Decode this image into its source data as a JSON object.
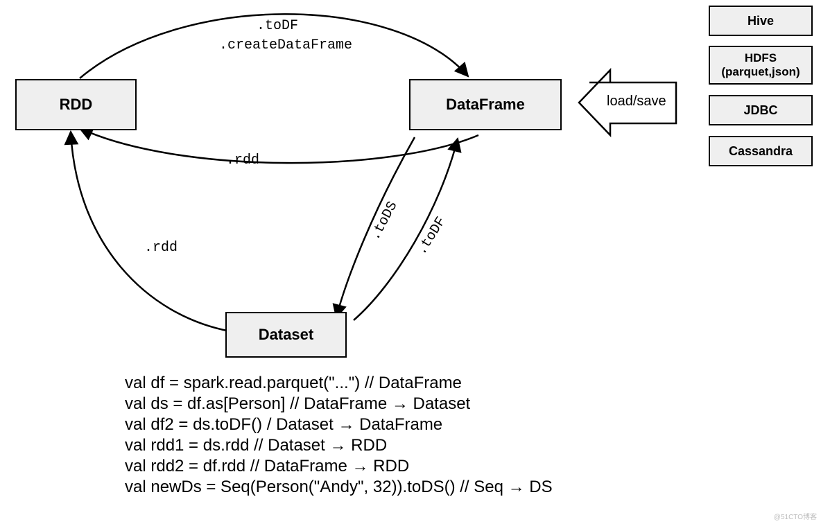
{
  "nodes": {
    "rdd": "RDD",
    "dataframe": "DataFrame",
    "dataset": "Dataset"
  },
  "edges": {
    "rdd_to_df_l1": ".toDF",
    "rdd_to_df_l2": ".createDataFrame",
    "df_to_rdd": ".rdd",
    "ds_to_rdd": ".rdd",
    "df_to_ds": ".toDS",
    "ds_to_df": ".toDF"
  },
  "load_save_label": "load/save",
  "sources": [
    "Hive",
    "HDFS\n(parquet,json)",
    "JDBC",
    "Cassandra"
  ],
  "code": [
    "val df = spark.read.parquet(\"...\") // DataFrame",
    "val ds = df.as[Person] // DataFrame → Dataset",
    "val df2 = ds.toDF() / Dataset → DataFrame",
    "val rdd1 = ds.rdd // Dataset → RDD",
    "val rdd2 = df.rdd // DataFrame → RDD",
    "val newDs = Seq(Person(\"Andy\", 32)).toDS() // Seq → DS"
  ],
  "watermark": "@51CTO博客"
}
